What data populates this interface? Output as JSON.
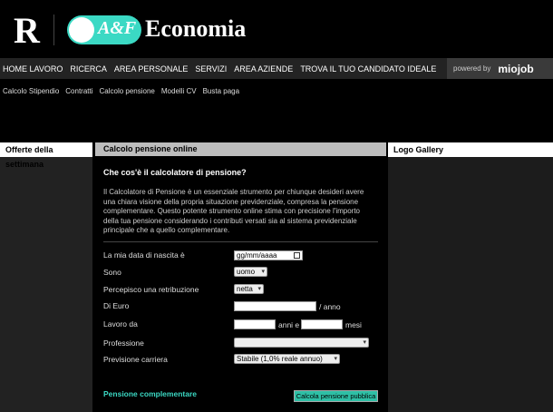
{
  "header": {
    "logo_r": "R",
    "brand_pill": "A&F",
    "brand_name": "Economia"
  },
  "nav": {
    "items": [
      "Home lavoro",
      "Ricerca",
      "Area personale",
      "Servizi",
      "Area aziende",
      "Trova il tuo candidato ideale"
    ],
    "powered_by": "powered by",
    "partner": "miojob"
  },
  "subnav": {
    "items": [
      "Calcolo Stipendio",
      "Contratti",
      "Calcolo pensione",
      "Modelli CV",
      "Busta paga"
    ]
  },
  "left_column": {
    "title": "Offerte della settimana"
  },
  "right_column": {
    "title": "Logo Gallery"
  },
  "main": {
    "title": "Calcolo pensione online",
    "question": "Che cos'è il calcolatore di pensione?",
    "intro": "Il Calcolatore di Pensione è un essenziale strumento per chiunque desideri avere una chiara visione della propria situazione previdenziale, compresa la pensione complementare. Questo potente strumento online stima con precisione l'importo della tua pensione considerando i contributi versati sia al sistema previdenziale principale che a quello complementare.",
    "form": {
      "birth_label": "La mia data di nascita è",
      "birth_placeholder": "gg/mm/aaaa",
      "sex_label": "Sono",
      "sex_value": "uomo",
      "salary_type_label": "Percepisco una retribuzione",
      "salary_type_value": "netta",
      "euro_label": "Di Euro",
      "euro_suffix": "/ anno",
      "work_label": "Lavoro da",
      "years_label": "anni e",
      "months_label": "mesi",
      "profession_label": "Professione",
      "profession_value": "",
      "career_label": "Previsione carriera",
      "career_value": "Stabile (1,0% reale annuo)"
    },
    "complementary_link": "Pensione complementare",
    "calc_button": "Calcola pensione pubblica"
  }
}
